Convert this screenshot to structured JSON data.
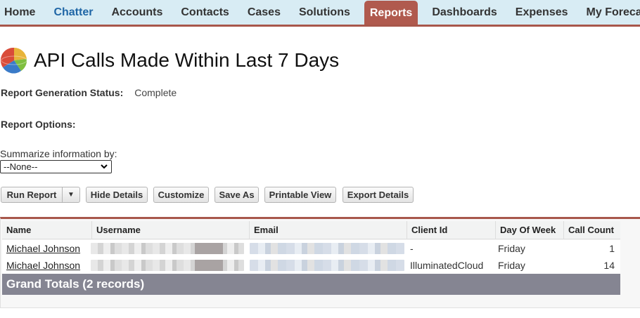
{
  "tabs": [
    {
      "label": "Home"
    },
    {
      "label": "Chatter"
    },
    {
      "label": "Accounts"
    },
    {
      "label": "Contacts"
    },
    {
      "label": "Cases"
    },
    {
      "label": "Solutions"
    },
    {
      "label": "Reports"
    },
    {
      "label": "Dashboards"
    },
    {
      "label": "Expenses"
    },
    {
      "label": "My Foreca"
    }
  ],
  "page": {
    "title": "API Calls Made Within Last 7 Days",
    "status_label": "Report Generation Status:",
    "status_value": "Complete",
    "options_label": "Report Options:",
    "summarize_label": "Summarize information by:",
    "summarize_value": "--None--"
  },
  "toolbar": {
    "run_report": "Run Report",
    "run_arrow": "▼",
    "hide_details": "Hide Details",
    "customize": "Customize",
    "save_as": "Save As",
    "printable_view": "Printable View",
    "export_details": "Export Details"
  },
  "table": {
    "columns": [
      "Name",
      "Username",
      "Email",
      "Client Id",
      "Day Of Week",
      "Call Count"
    ],
    "rows": [
      {
        "name": "Michael Johnson",
        "client_id": "-",
        "day": "Friday",
        "count": "1"
      },
      {
        "name": "Michael Johnson",
        "client_id": "IlluminatedCloud",
        "day": "Friday",
        "count": "14"
      }
    ],
    "grand_totals": "Grand Totals (2 records)"
  },
  "colors": {
    "accent": "#a8574b",
    "active_tab": "#b05a4e",
    "tab_bar": "#d8ecf4",
    "totals_bg": "#858592"
  }
}
